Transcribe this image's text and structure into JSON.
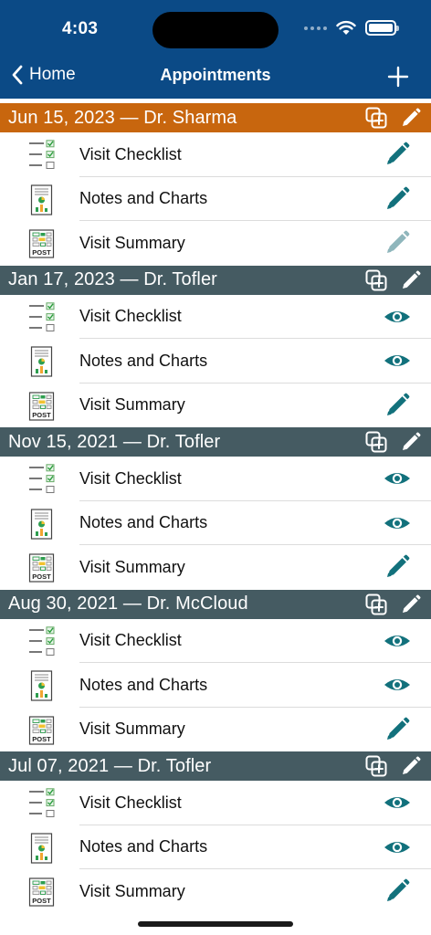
{
  "status": {
    "time": "4:03"
  },
  "nav": {
    "back_label": "Home",
    "title": "Appointments"
  },
  "colors": {
    "topbar": "#0b4a86",
    "header_active": "#c8660e",
    "header_default": "#455b62",
    "action": "#12717c",
    "action_disabled": "#8fb6bc"
  },
  "appointments": [
    {
      "title": "Jun 15, 2023 — Dr. Sharma",
      "active": true,
      "rows": [
        {
          "label": "Visit Checklist",
          "icon": "checklist-icon",
          "action": "pencil-icon",
          "disabled": false
        },
        {
          "label": "Notes and Charts",
          "icon": "notes-chart-icon",
          "action": "pencil-icon",
          "disabled": false
        },
        {
          "label": "Visit Summary",
          "icon": "post-summary-icon",
          "action": "pencil-icon",
          "disabled": true
        }
      ]
    },
    {
      "title": "Jan 17, 2023 — Dr. Tofler",
      "active": false,
      "rows": [
        {
          "label": "Visit Checklist",
          "icon": "checklist-icon",
          "action": "eye-icon",
          "disabled": false
        },
        {
          "label": "Notes and Charts",
          "icon": "notes-chart-icon",
          "action": "eye-icon",
          "disabled": false
        },
        {
          "label": "Visit Summary",
          "icon": "post-summary-icon",
          "action": "pencil-icon",
          "disabled": false
        }
      ]
    },
    {
      "title": "Nov 15, 2021 — Dr. Tofler",
      "active": false,
      "rows": [
        {
          "label": "Visit Checklist",
          "icon": "checklist-icon",
          "action": "eye-icon",
          "disabled": false
        },
        {
          "label": "Notes and Charts",
          "icon": "notes-chart-icon",
          "action": "eye-icon",
          "disabled": false
        },
        {
          "label": "Visit Summary",
          "icon": "post-summary-icon",
          "action": "pencil-icon",
          "disabled": false
        }
      ]
    },
    {
      "title": "Aug 30, 2021 — Dr. McCloud",
      "active": false,
      "rows": [
        {
          "label": "Visit Checklist",
          "icon": "checklist-icon",
          "action": "eye-icon",
          "disabled": false
        },
        {
          "label": "Notes and Charts",
          "icon": "notes-chart-icon",
          "action": "eye-icon",
          "disabled": false
        },
        {
          "label": "Visit Summary",
          "icon": "post-summary-icon",
          "action": "pencil-icon",
          "disabled": false
        }
      ]
    },
    {
      "title": "Jul 07, 2021 — Dr. Tofler",
      "active": false,
      "rows": [
        {
          "label": "Visit Checklist",
          "icon": "checklist-icon",
          "action": "eye-icon",
          "disabled": false
        },
        {
          "label": "Notes and Charts",
          "icon": "notes-chart-icon",
          "action": "eye-icon",
          "disabled": false
        },
        {
          "label": "Visit Summary",
          "icon": "post-summary-icon",
          "action": "pencil-icon",
          "disabled": false
        }
      ]
    }
  ]
}
